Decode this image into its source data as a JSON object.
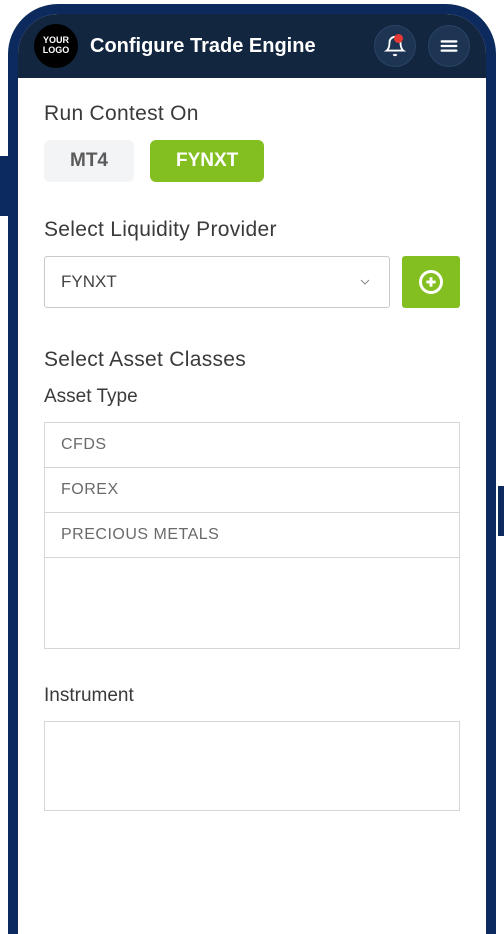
{
  "header": {
    "logo_text": "YOUR LOGO",
    "title": "Configure Trade Engine"
  },
  "contest": {
    "label": "Run Contest On",
    "options": [
      {
        "label": "MT4",
        "active": false
      },
      {
        "label": "FYNXT",
        "active": true
      }
    ]
  },
  "liquidity": {
    "label": "Select Liquidity Provider",
    "selected": "FYNXT"
  },
  "asset": {
    "section_label": "Select Asset Classes",
    "type_label": "Asset Type",
    "types": [
      "CFDS",
      "FOREX",
      "PRECIOUS METALS"
    ],
    "instrument_label": "Instrument"
  },
  "colors": {
    "accent": "#84bf21",
    "header_bg": "#13263f",
    "frame": "#0c2a5e",
    "alert": "#e53935"
  }
}
